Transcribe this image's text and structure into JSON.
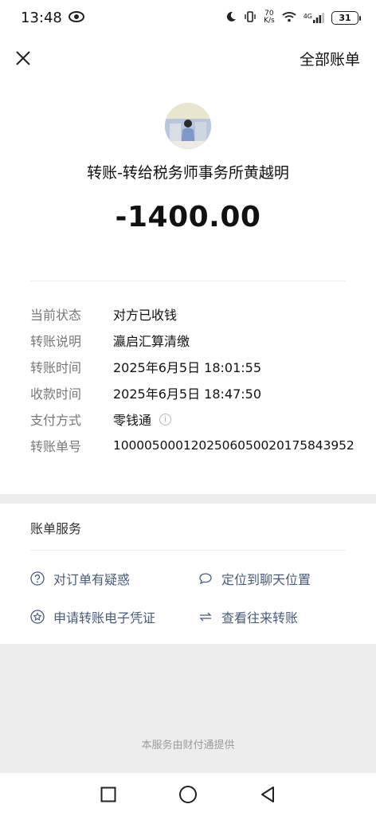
{
  "status_bar": {
    "time": "13:48",
    "network_speed_top": "70",
    "network_speed_unit": "K/s",
    "network_type": "4G",
    "battery": "31"
  },
  "header": {
    "close_icon": "close-icon",
    "right_label": "全部账单"
  },
  "transfer": {
    "title": "转账-转给税务师事务所黄越明",
    "amount": "-1400.00"
  },
  "details": [
    {
      "label": "当前状态",
      "value": "对方已收钱"
    },
    {
      "label": "转账说明",
      "value": "瀛启汇算清缴"
    },
    {
      "label": "转账时间",
      "value": "2025年6月5日 18:01:55"
    },
    {
      "label": "收款时间",
      "value": "2025年6月5日 18:47:50"
    },
    {
      "label": "支付方式",
      "value": "零钱通"
    },
    {
      "label": "转账单号",
      "value": "100005000120250605002017584395​2"
    }
  ],
  "services": {
    "title": "账单服务",
    "items": [
      {
        "label": "对订单有疑惑",
        "icon": "question-circle-icon"
      },
      {
        "label": "定位到聊天位置",
        "icon": "chat-bubble-icon"
      },
      {
        "label": "申请转账电子凭证",
        "icon": "star-badge-icon"
      },
      {
        "label": "查看往来转账",
        "icon": "swap-arrows-icon"
      }
    ]
  },
  "footer": {
    "provider_text": "本服务由财付通提供"
  },
  "colors": {
    "link": "#4a5b7a",
    "label": "#777777",
    "background": "#ededed"
  }
}
